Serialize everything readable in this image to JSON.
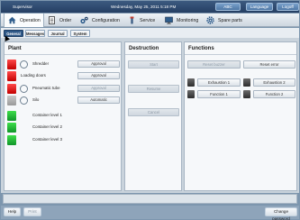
{
  "titlebar": {
    "user": "Supervisor",
    "datetime": "Wednesday, May 25, 2011 5:18 PM",
    "abc_label": "ABC",
    "language_label": "Language",
    "logoff_label": "Logoff"
  },
  "main_tabs": [
    {
      "label": "Operation",
      "icon": "home-icon",
      "active": true
    },
    {
      "label": "Order",
      "icon": "document-icon",
      "active": false
    },
    {
      "label": "Configuration",
      "icon": "gears-icon",
      "active": false
    },
    {
      "label": "Service",
      "icon": "wrench-icon",
      "active": false
    },
    {
      "label": "Monitoring",
      "icon": "monitor-icon",
      "active": false
    },
    {
      "label": "Spare parts",
      "icon": "cog-icon",
      "active": false
    }
  ],
  "sub_tabs": [
    {
      "label": "General",
      "active": true
    },
    {
      "label": "Messages",
      "active": false
    },
    {
      "label": "Journal",
      "active": false
    },
    {
      "label": "System",
      "active": false
    }
  ],
  "plant": {
    "title": "Plant",
    "rows": [
      {
        "label": "Shredder",
        "status_color": "red",
        "button": "Approval",
        "button_enabled": true
      },
      {
        "label": "Loading doors",
        "status_color": "red",
        "button": "Approval",
        "button_enabled": true
      },
      {
        "label": "Pneumatic tube",
        "status_color": "red",
        "button": "Approval",
        "button_enabled": false
      },
      {
        "label": "Silo",
        "status_color": "grey",
        "button": "Automatic",
        "button_enabled": true
      },
      {
        "label": "Container level 1",
        "status_color": "green"
      },
      {
        "label": "Container level 2",
        "status_color": "green"
      },
      {
        "label": "Container level 3",
        "status_color": "green"
      }
    ]
  },
  "destruction": {
    "title": "Destruction",
    "start": "Start",
    "resume": "Resume",
    "cancel": "Cancel"
  },
  "functions": {
    "title": "Functions",
    "reset_buzzer": "Reset buzzer",
    "reset_error": "Reset error",
    "exhaustion1": "Exhaustion 1",
    "exhaustion2": "Exhaustion 2",
    "function1": "Function 1",
    "function2": "Function 2"
  },
  "bottom": {
    "help": "Help",
    "print": "Print",
    "change_password": "Change password"
  },
  "colors": {
    "status_red": "#e00000",
    "status_green": "#22c03a",
    "accent_blue": "#2e5887"
  }
}
